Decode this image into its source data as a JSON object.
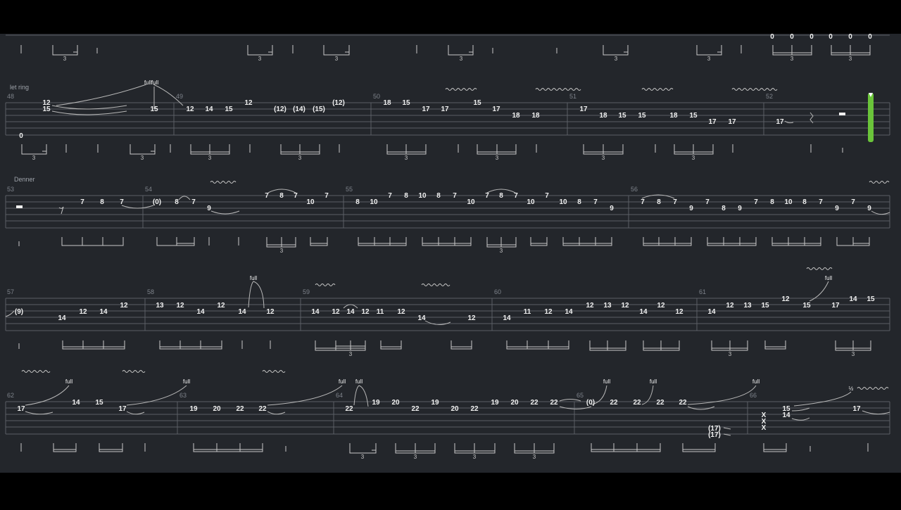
{
  "theme": {
    "background": "#23262b",
    "letterbox": "#000000",
    "staff_line": "#5b5f66",
    "note_text": "#f0f0f0",
    "annotation_text": "#9ea3aa",
    "bar_number": "#7d828a",
    "cursor": "#6ac43a"
  },
  "top_row": {
    "notes": [
      "0",
      "0",
      "0",
      "0",
      "0",
      "0"
    ],
    "triplet_labels": [
      "3",
      "3",
      "3",
      "3",
      "3",
      "3",
      "3",
      "3"
    ]
  },
  "rows": [
    {
      "annotations": [
        "let ring"
      ],
      "bar_numbers": [
        "48",
        "49",
        "50",
        "51",
        "52"
      ],
      "notes": [
        "12",
        "15",
        "0",
        "15",
        "12",
        "14",
        "15",
        "12",
        "(12)",
        "(14)",
        "(15)",
        "(12)",
        "18",
        "15",
        "17",
        "17",
        "15",
        "17",
        "18",
        "18",
        "17",
        "18",
        "15",
        "15",
        "18",
        "15",
        "17",
        "17",
        "17"
      ],
      "bends": [
        "full",
        "full"
      ],
      "triplet_labels": [
        "3",
        "3",
        "3",
        "3",
        "3",
        "3",
        "3",
        "3"
      ]
    },
    {
      "annotations": [
        "Denner"
      ],
      "bar_numbers": [
        "53",
        "54",
        "55",
        "56"
      ],
      "notes": [
        "7",
        "8",
        "7",
        "(0)",
        "8",
        "7",
        "9",
        "7",
        "8",
        "7",
        "7",
        "10",
        "8",
        "10",
        "7",
        "8",
        "10",
        "8",
        "7",
        "10",
        "7",
        "8",
        "7",
        "7",
        "10",
        "10",
        "8",
        "7",
        "9",
        "7",
        "8",
        "7",
        "9",
        "7",
        "8",
        "9",
        "7",
        "8",
        "10",
        "8",
        "7",
        "9",
        "7",
        "9"
      ],
      "triplet_labels": [
        "3",
        "3"
      ]
    },
    {
      "bar_numbers": [
        "57",
        "58",
        "59",
        "60",
        "61"
      ],
      "notes": [
        "(9)",
        "14",
        "12",
        "14",
        "12",
        "13",
        "12",
        "14",
        "12",
        "14",
        "12",
        "14",
        "12",
        "14",
        "12",
        "11",
        "12",
        "14",
        "12",
        "14",
        "11",
        "12",
        "14",
        "12",
        "13",
        "12",
        "14",
        "12",
        "12",
        "14",
        "12",
        "13",
        "15",
        "12",
        "15",
        "17",
        "14",
        "15"
      ],
      "bends": [
        "full",
        "full"
      ],
      "triplet_labels": [
        "3",
        "3",
        "3"
      ]
    },
    {
      "bar_numbers": [
        "62",
        "63",
        "64",
        "65",
        "66"
      ],
      "notes": [
        "17",
        "14",
        "15",
        "17",
        "19",
        "20",
        "22",
        "22",
        "22",
        "19",
        "20",
        "22",
        "19",
        "20",
        "22",
        "19",
        "20",
        "22",
        "22",
        "(0)",
        "22",
        "22",
        "22",
        "22",
        "(17)",
        "(17)",
        "X",
        "X",
        "X",
        "15",
        "14",
        "17"
      ],
      "bends": [
        "full",
        "full",
        "full",
        "full",
        "full",
        "full",
        "full",
        "½"
      ],
      "triplet_labels": [
        "3",
        "3",
        "3",
        "3"
      ]
    }
  ]
}
